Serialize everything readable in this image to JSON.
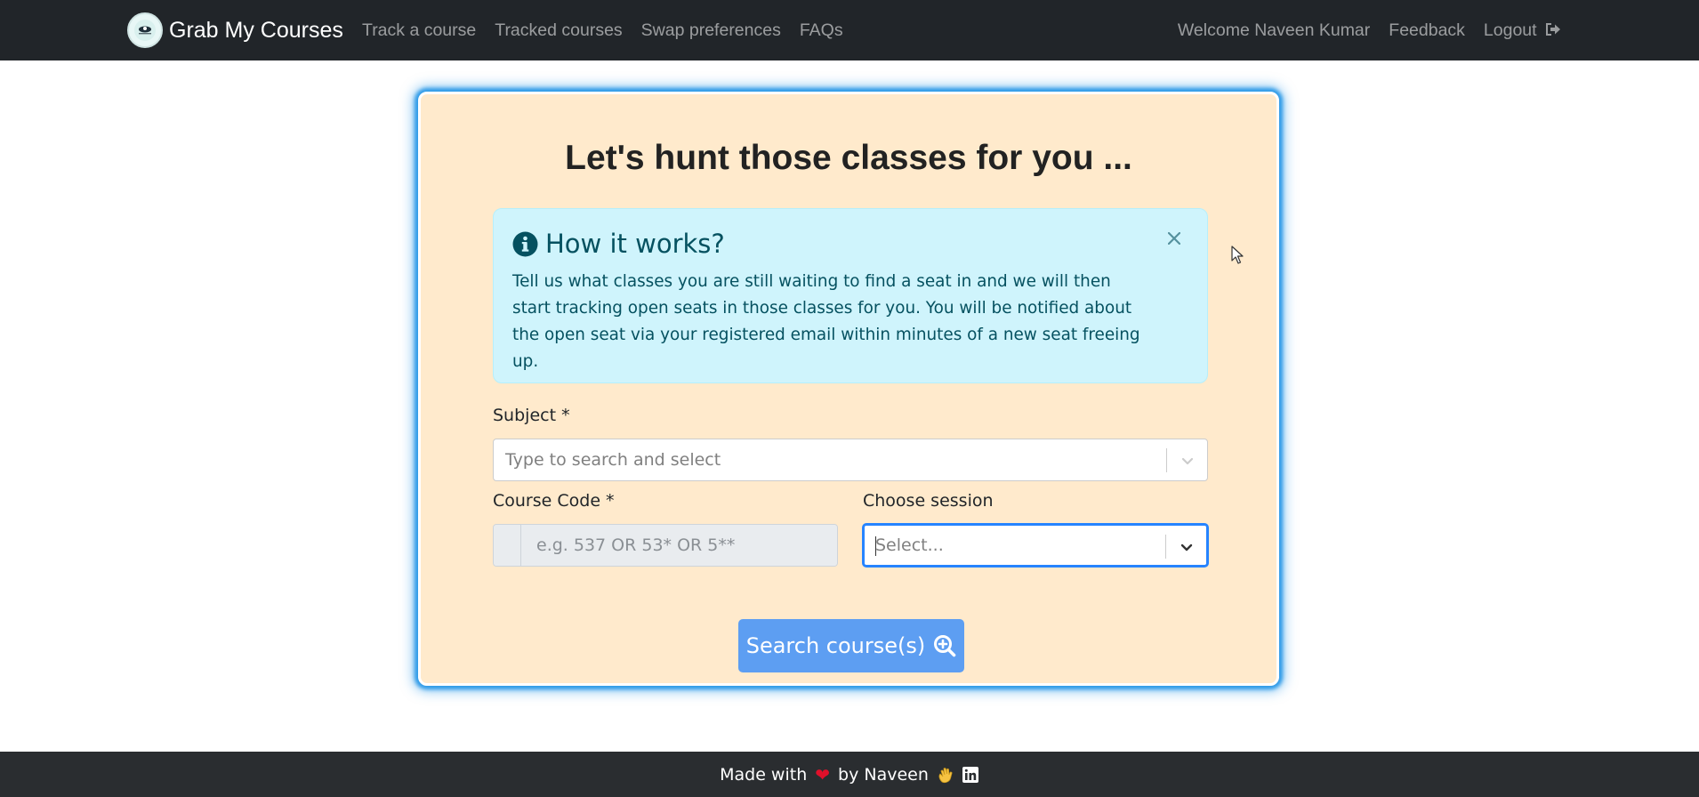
{
  "navbar": {
    "brand": "Grab My Courses",
    "links": [
      "Track a course",
      "Tracked courses",
      "Swap preferences",
      "FAQs"
    ],
    "welcome": "Welcome Naveen Kumar",
    "feedback": "Feedback",
    "logout": "Logout"
  },
  "card": {
    "title": "Let's hunt those classes for you ...",
    "alert": {
      "heading": "How it works?",
      "body": "Tell us what classes you are still waiting to find a seat in and we will then start tracking open seats in those classes for you. You will be notified about the open seat via your registered email within minutes of a new seat freeing up."
    },
    "subject": {
      "label": "Subject *",
      "placeholder": "Type to search and select"
    },
    "course_code": {
      "label": "Course Code *",
      "placeholder": "e.g. 537 OR 53* OR 5**"
    },
    "session": {
      "label": "Choose session",
      "placeholder": "Select..."
    },
    "search_button": "Search course(s)"
  },
  "footer": {
    "made_with": "Made with",
    "by": "by Naveen"
  },
  "colors": {
    "navbar_bg": "#212529",
    "card_bg": "#ffeacc",
    "card_glow": "#2f9be8",
    "alert_bg": "#cff4fc",
    "alert_text": "#055160",
    "button_bg": "#5d9ef2",
    "focus_border": "#2684ff",
    "footer_bg": "#2a2d30"
  }
}
